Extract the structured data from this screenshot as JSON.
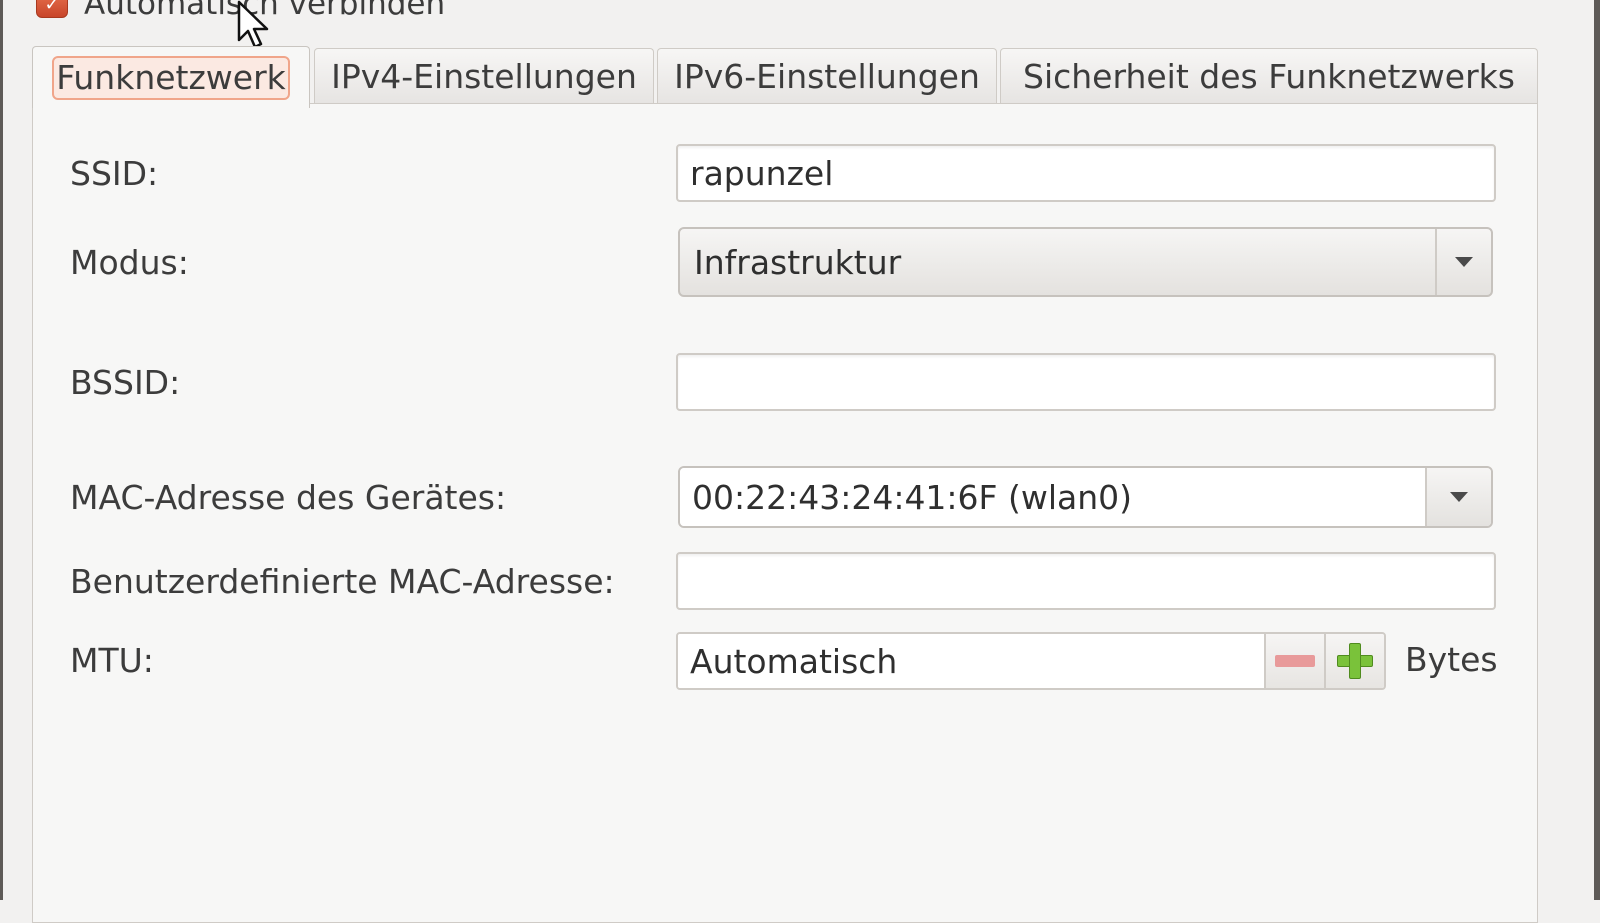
{
  "autoconnect": {
    "label": "Automatisch verbinden",
    "checked": true
  },
  "tabs": [
    {
      "label": "Funknetzwerk",
      "active": true
    },
    {
      "label": "IPv4-Einstellungen",
      "active": false
    },
    {
      "label": "IPv6-Einstellungen",
      "active": false
    },
    {
      "label": "Sicherheit des Funknetzwerks",
      "active": false
    }
  ],
  "form": {
    "ssid": {
      "label": "SSID:",
      "value": "rapunzel"
    },
    "mode": {
      "label": "Modus:",
      "value": "Infrastruktur"
    },
    "bssid": {
      "label": "BSSID:",
      "value": ""
    },
    "device_mac": {
      "label": "MAC-Adresse des Gerätes:",
      "value": "00:22:43:24:41:6F (wlan0)"
    },
    "custom_mac": {
      "label": "Benutzerdefinierte MAC-Adresse:",
      "value": ""
    },
    "mtu": {
      "label": "MTU:",
      "value": "Automatisch",
      "unit": "Bytes"
    }
  },
  "colors": {
    "accent": "#e9734f",
    "plus": "#7ac23a",
    "minus": "#e89a9a"
  }
}
